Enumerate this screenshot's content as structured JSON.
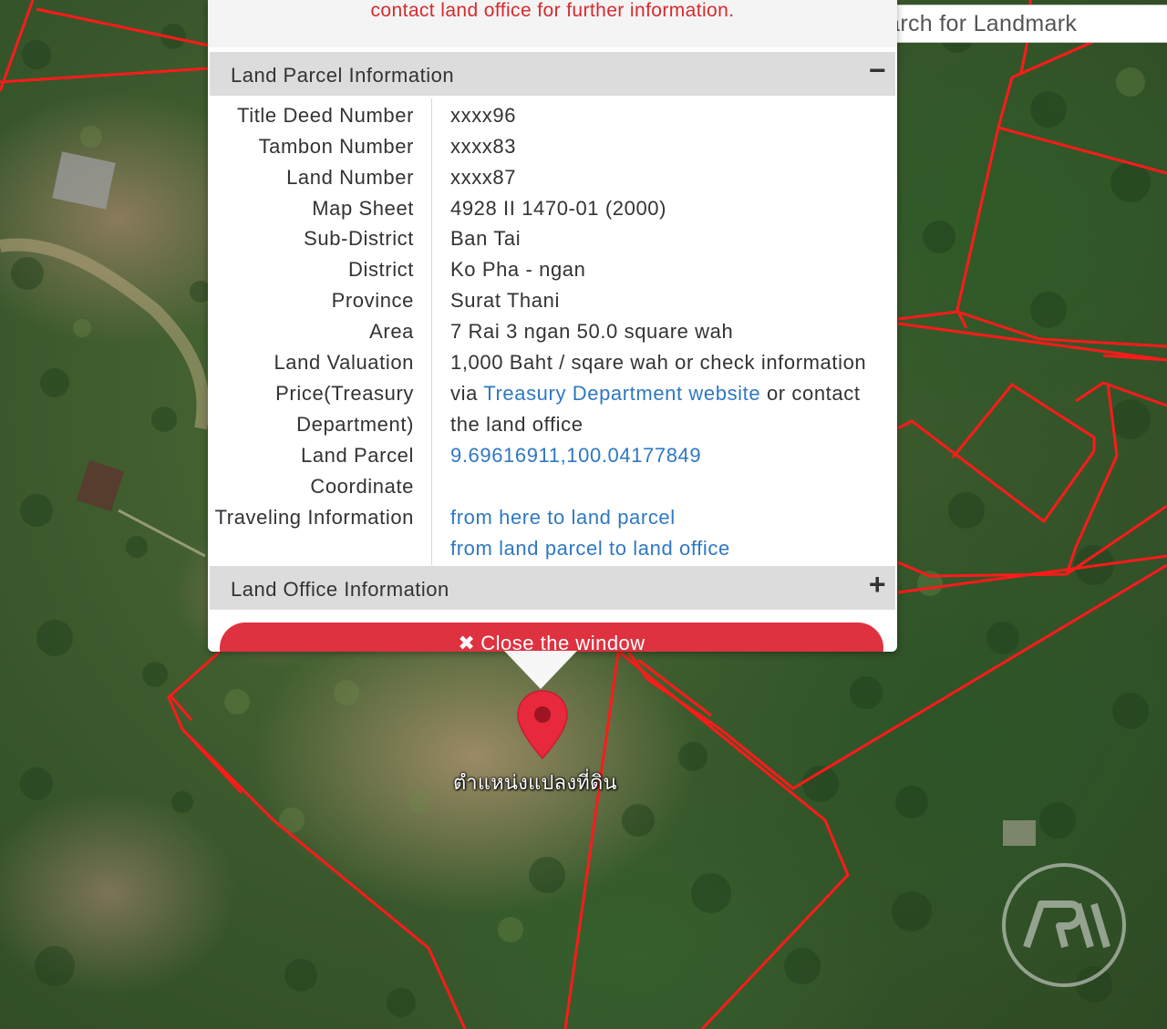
{
  "notice": {
    "text": "contact land office for further information."
  },
  "search": {
    "placeholder": "Search for Landmark"
  },
  "land_parcel_panel": {
    "title": "Land Parcel Information",
    "toggle_icon": "minus",
    "rows": [
      {
        "label": "Title Deed Number",
        "value": "xxxx96"
      },
      {
        "label": "Tambon Number",
        "value": "xxxx83"
      },
      {
        "label": "Land Number",
        "value": "xxxx87"
      },
      {
        "label": "Map Sheet",
        "value": "4928 II 1470-01 (2000)"
      },
      {
        "label": "Sub-District",
        "value": "Ban Tai"
      },
      {
        "label": "District",
        "value": "Ko Pha - ngan"
      },
      {
        "label": "Province",
        "value": "Surat Thani"
      },
      {
        "label": "Area",
        "value": "7 Rai 3 ngan 50.0 square wah"
      }
    ],
    "valuation": {
      "label_line1": "Land Valuation",
      "label_line2": "Price(Treasury",
      "label_line3": "Department)",
      "value_line1": "1,000 Baht / sqare wah or check information",
      "value_line2_prefix": "via",
      "value_link": "Treasury Department website",
      "value_line2_suffix": "or contact",
      "value_line3": "the land office"
    },
    "coordinate": {
      "label_line1": "Land Parcel",
      "label_line2": "Coordinate",
      "value": "9.69616911,100.04177849"
    },
    "traveling": {
      "label": "Traveling Information",
      "link1": "from here to land parcel",
      "link2": "from land parcel to land office"
    }
  },
  "land_office_panel": {
    "title": "Land Office Information",
    "toggle_icon": "plus"
  },
  "close_button": {
    "label": "Close the window",
    "icon": "close-icon"
  },
  "marker": {
    "label": "ตำแหน่งแปลงที่ดิน",
    "icon": "map-pin-icon"
  },
  "colors": {
    "accent_red": "#de3241",
    "notice_red": "#d9292d",
    "link_blue": "#2f78c2",
    "parcel_line": "#ff1a1a"
  }
}
